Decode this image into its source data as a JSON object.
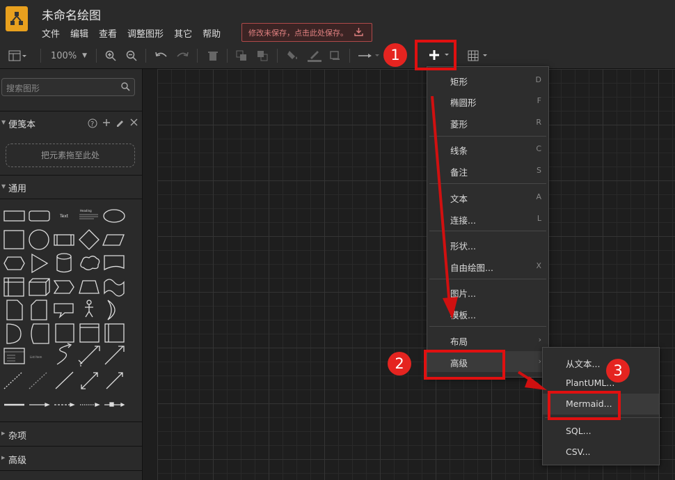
{
  "app": {
    "title": "未命名绘图"
  },
  "menubar": [
    "文件",
    "编辑",
    "查看",
    "调整图形",
    "其它",
    "帮助"
  ],
  "unsaved_notice": "修改未保存，点击此处保存。",
  "toolbar": {
    "zoom": "100%"
  },
  "sidebar": {
    "search_placeholder": "搜索图形",
    "scratchpad_title": "便笺本",
    "scratchpad_drop": "把元素拖至此处",
    "general_title": "通用",
    "misc_title": "杂项",
    "advanced_title": "高级",
    "shape_labels": {
      "text": "Text",
      "heading": "Heading",
      "list": "List Item"
    }
  },
  "insert_menu": {
    "items": [
      {
        "label": "矩形",
        "shortcut": "D"
      },
      {
        "label": "椭圆形",
        "shortcut": "F"
      },
      {
        "label": "菱形",
        "shortcut": "R"
      },
      {
        "label": "线条",
        "shortcut": "C"
      },
      {
        "label": "备注",
        "shortcut": "S"
      },
      {
        "label": "文本",
        "shortcut": "A"
      },
      {
        "label": "连接...",
        "shortcut": "L"
      },
      {
        "label": "形状...",
        "shortcut": ""
      },
      {
        "label": "自由绘图...",
        "shortcut": "X"
      },
      {
        "label": "图片...",
        "shortcut": ""
      },
      {
        "label": "模板...",
        "shortcut": ""
      },
      {
        "label": "布局",
        "shortcut": "›"
      },
      {
        "label": "高级",
        "shortcut": "›"
      }
    ]
  },
  "advanced_submenu": {
    "items": [
      "从文本...",
      "PlantUML...",
      "Mermaid...",
      "SQL...",
      "CSV..."
    ]
  },
  "annotations": {
    "step1": "1",
    "step2": "2",
    "step3": "3",
    "color": "#e01010"
  }
}
